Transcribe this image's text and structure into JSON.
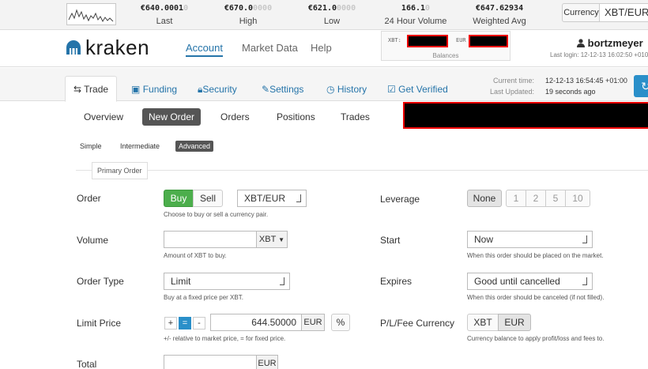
{
  "ticker": {
    "last": {
      "main": "€640.0001",
      "fade": "0",
      "label": "Last"
    },
    "high": {
      "main": "€670.0",
      "fade": "0000",
      "label": "High"
    },
    "low": {
      "main": "€621.0",
      "fade": "0000",
      "label": "Low"
    },
    "volume": {
      "main": "166.1",
      "fade": "0",
      "label": "24 Hour Volume"
    },
    "avg": {
      "main": "€647.62934",
      "fade": "",
      "label": "Weighted Avg"
    },
    "currency_label": "Currency",
    "currency_value": "XBT/EUR"
  },
  "header": {
    "logo_text": "kraken",
    "nav": [
      "Account",
      "Market Data",
      "Help"
    ],
    "balances": {
      "xbt_label": "XBT:",
      "eur_label": "EUR",
      "caption": "Balances"
    },
    "username": "bortzmeyer",
    "last_login": "Last login: 12-12-13 16:02:50 +010"
  },
  "tabs": [
    "Trade",
    "Funding",
    "Security",
    "Settings",
    "History",
    "Get Verified"
  ],
  "time": {
    "current_label": "Current time:",
    "current_value": "12-12-13 16:54:45 +01:00",
    "updated_label": "Last Updated:",
    "updated_value": "19 seconds ago"
  },
  "subnav": [
    "Overview",
    "New Order",
    "Orders",
    "Positions",
    "Trades"
  ],
  "modes": [
    "Simple",
    "Intermediate",
    "Advanced"
  ],
  "section_legend": "Primary Order",
  "form": {
    "order": {
      "label": "Order",
      "buy": "Buy",
      "sell": "Sell",
      "pair": "XBT/EUR",
      "help": "Choose to buy or sell a currency pair."
    },
    "volume": {
      "label": "Volume",
      "value": "",
      "unit": "XBT",
      "help": "Amount of XBT to buy."
    },
    "order_type": {
      "label": "Order Type",
      "value": "Limit",
      "help": "Buy at a fixed price per XBT."
    },
    "limit_price": {
      "label": "Limit Price",
      "plus": "+",
      "equals": "=",
      "minus": "-",
      "value": "644.50000",
      "unit": "EUR",
      "pct": "%",
      "help": "+/- relative to market price, = for fixed price."
    },
    "total": {
      "label": "Total",
      "unit": "EUR"
    },
    "leverage": {
      "label": "Leverage",
      "options": [
        "None",
        "1",
        "2",
        "5",
        "10"
      ]
    },
    "start": {
      "label": "Start",
      "value": "Now",
      "help": "When this order should be placed on the market."
    },
    "expires": {
      "label": "Expires",
      "value": "Good until cancelled",
      "help": "When this order should be canceled (if not filled)."
    },
    "fee_currency": {
      "label": "P/L/Fee Currency",
      "xbt": "XBT",
      "eur": "EUR",
      "help": "Currency balance to apply profit/loss and fees to."
    }
  },
  "colors": {
    "accent": "#2574a9",
    "buy_green": "#4cae4c",
    "redact": "#000000",
    "redact_border": "#ee0000"
  }
}
